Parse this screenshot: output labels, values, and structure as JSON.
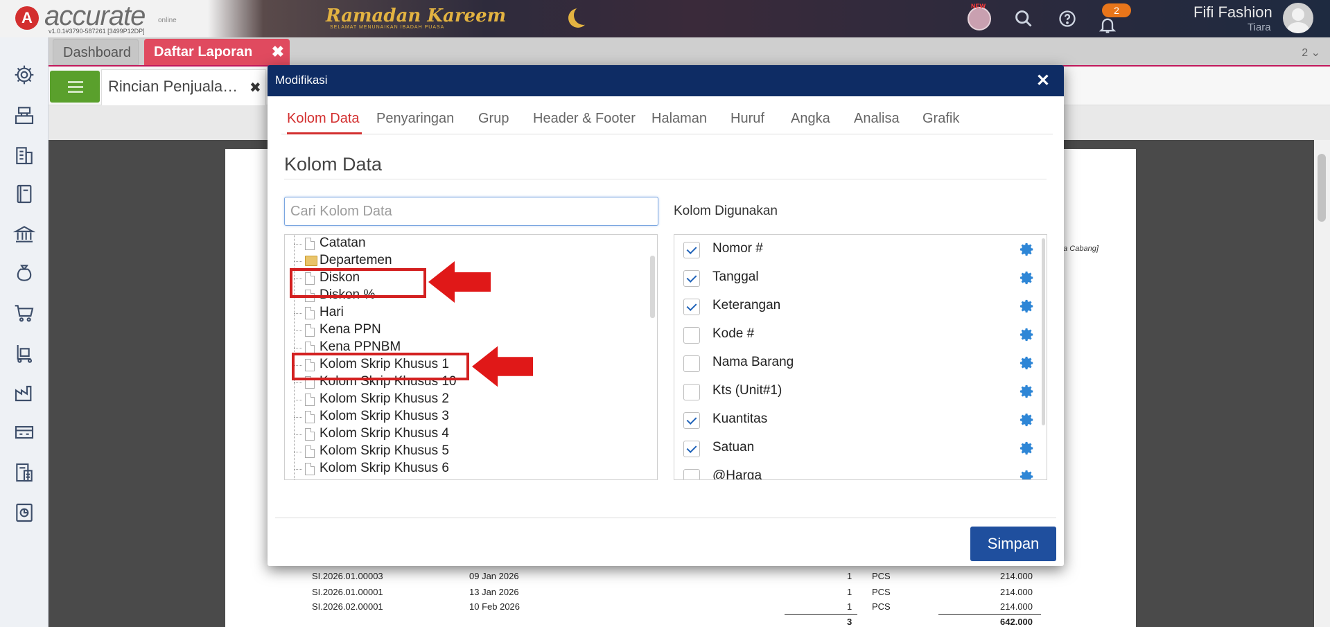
{
  "topbar": {
    "logo_letter": "A",
    "logo_text": "accurate",
    "logo_online": "online",
    "version": "v1.0.1#3790-587261 [3499P12DP]",
    "banner_title": "Ramadan Kareem",
    "banner_sub": "SELAMAT MENUNAIKAN IBADAH PUASA",
    "new_badge": "NEW",
    "notif_count": "2",
    "user_name": "Fifi Fashion",
    "user_sub": "Tiara"
  },
  "sidebar": {
    "icons": [
      "gear-icon",
      "cashier-icon",
      "building-icon",
      "book-icon",
      "bank-icon",
      "money-bag-icon",
      "cart-icon",
      "trolley-icon",
      "factory-icon",
      "warehouse-icon",
      "tax-icon",
      "report-chart-icon"
    ]
  },
  "tabs": {
    "dashboard": "Dashboard",
    "daftar_laporan": "Daftar Laporan",
    "close_symbol": "✖",
    "count": "2 ⌄"
  },
  "subtab": {
    "label": "Rincian Penjuala…",
    "close_symbol": "✖"
  },
  "report": {
    "note": "ua Cabang]",
    "rows": [
      {
        "no": "SI.2026.01.00003",
        "date": "09 Jan 2026",
        "qty": "1",
        "unit": "PCS",
        "price": "214.000"
      },
      {
        "no": "SI.2026.01.00001",
        "date": "13 Jan 2026",
        "qty": "1",
        "unit": "PCS",
        "price": "214.000"
      },
      {
        "no": "SI.2026.02.00001",
        "date": "10 Feb 2026",
        "qty": "1",
        "unit": "PCS",
        "price": "214.000"
      }
    ],
    "total_qty": "3",
    "total_price": "642.000"
  },
  "modal": {
    "title": "Modifikasi",
    "close_symbol": "✕",
    "tabs": [
      "Kolom Data",
      "Penyaringan",
      "Grup",
      "Header & Footer",
      "Halaman",
      "Huruf",
      "Angka",
      "Analisa",
      "Grafik"
    ],
    "active_tab": "Kolom Data",
    "section_title": "Kolom Data",
    "search_placeholder": "Cari Kolom Data",
    "tree_items": [
      {
        "label": "Catatan",
        "type": "file"
      },
      {
        "label": "Departemen",
        "type": "folder"
      },
      {
        "label": "Diskon",
        "type": "file"
      },
      {
        "label": "Diskon %",
        "type": "file"
      },
      {
        "label": "Hari",
        "type": "file"
      },
      {
        "label": "Kena PPN",
        "type": "file"
      },
      {
        "label": "Kena PPNBM",
        "type": "file"
      },
      {
        "label": "Kolom Skrip Khusus 1",
        "type": "file"
      },
      {
        "label": "Kolom Skrip Khusus 10",
        "type": "file"
      },
      {
        "label": "Kolom Skrip Khusus 2",
        "type": "file"
      },
      {
        "label": "Kolom Skrip Khusus 3",
        "type": "file"
      },
      {
        "label": "Kolom Skrip Khusus 4",
        "type": "file"
      },
      {
        "label": "Kolom Skrip Khusus 5",
        "type": "file"
      },
      {
        "label": "Kolom Skrip Khusus 6",
        "type": "file"
      }
    ],
    "used_label": "Kolom Digunakan",
    "used_columns": [
      {
        "label": "Nomor #",
        "checked": true
      },
      {
        "label": "Tanggal",
        "checked": true
      },
      {
        "label": "Keterangan",
        "checked": true
      },
      {
        "label": "Kode #",
        "checked": false
      },
      {
        "label": "Nama Barang",
        "checked": false
      },
      {
        "label": "Kts (Unit#1)",
        "checked": false
      },
      {
        "label": "Kuantitas",
        "checked": true
      },
      {
        "label": "Satuan",
        "checked": true
      },
      {
        "label": "@Harga",
        "checked": false
      }
    ],
    "save_label": "Simpan"
  },
  "colors": {
    "header_navy": "#0e2c64",
    "active_tab_red": "#d32f2f",
    "save_blue": "#1f4f9e",
    "annotation_red": "#d32020",
    "gear_blue": "#2e86d6"
  }
}
